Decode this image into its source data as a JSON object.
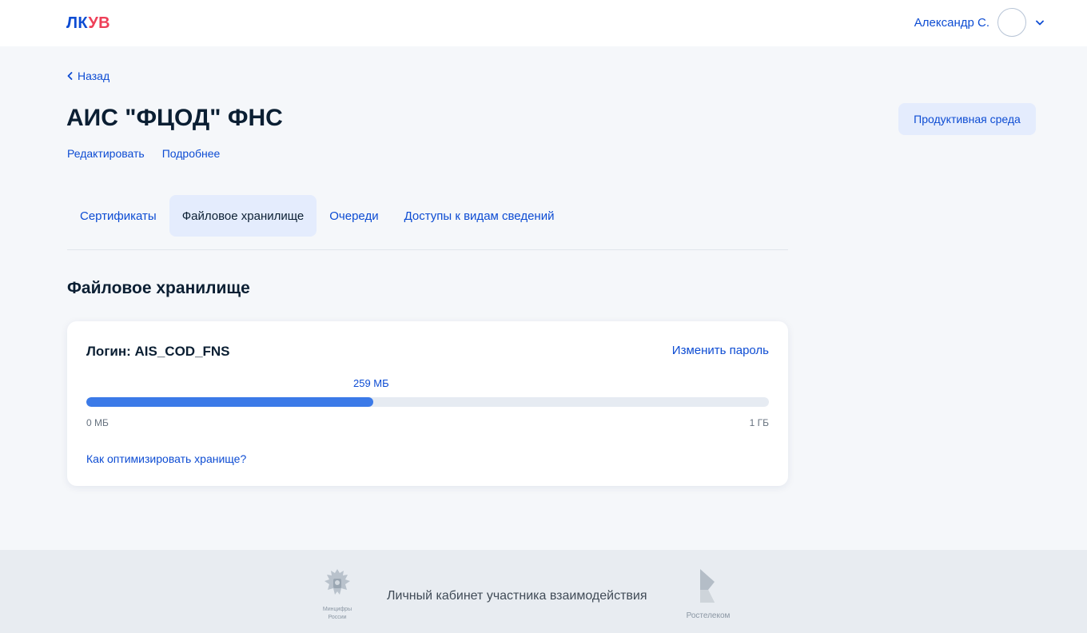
{
  "header": {
    "logo_part1": "ЛК",
    "logo_part2": "УВ",
    "user_name": "Александр С."
  },
  "page": {
    "back_label": "Назад",
    "title": "АИС \"ФЦОД\" ФНС",
    "edit_link": "Редактировать",
    "details_link": "Подробнее",
    "environment_badge": "Продуктивная среда"
  },
  "tabs": [
    {
      "label": "Сертификаты",
      "active": false
    },
    {
      "label": "Файловое хранилище",
      "active": true
    },
    {
      "label": "Очереди",
      "active": false
    },
    {
      "label": "Доступы к видам сведений",
      "active": false
    }
  ],
  "storage": {
    "section_title": "Файловое хранилище",
    "login_label": "Логин: AIS_COD_FNS",
    "change_password": "Изменить пароль",
    "used_label": "259 МБ",
    "used_fraction": 0.42,
    "min_label": "0 МБ",
    "max_label": "1 ГБ",
    "optimize_link": "Как оптимизировать хранище?"
  },
  "footer": {
    "ministry_caption_1": "Минцифры",
    "ministry_caption_2": "России",
    "text": "Личный кабинет участника взаимодействия",
    "rostelecom_caption": "Ростелеком"
  },
  "colors": {
    "accent": "#0d4cd3",
    "logo_red": "#ee3f58",
    "progress_fill": "#3b7ae8",
    "active_tab_bg": "#e4ecfd"
  }
}
